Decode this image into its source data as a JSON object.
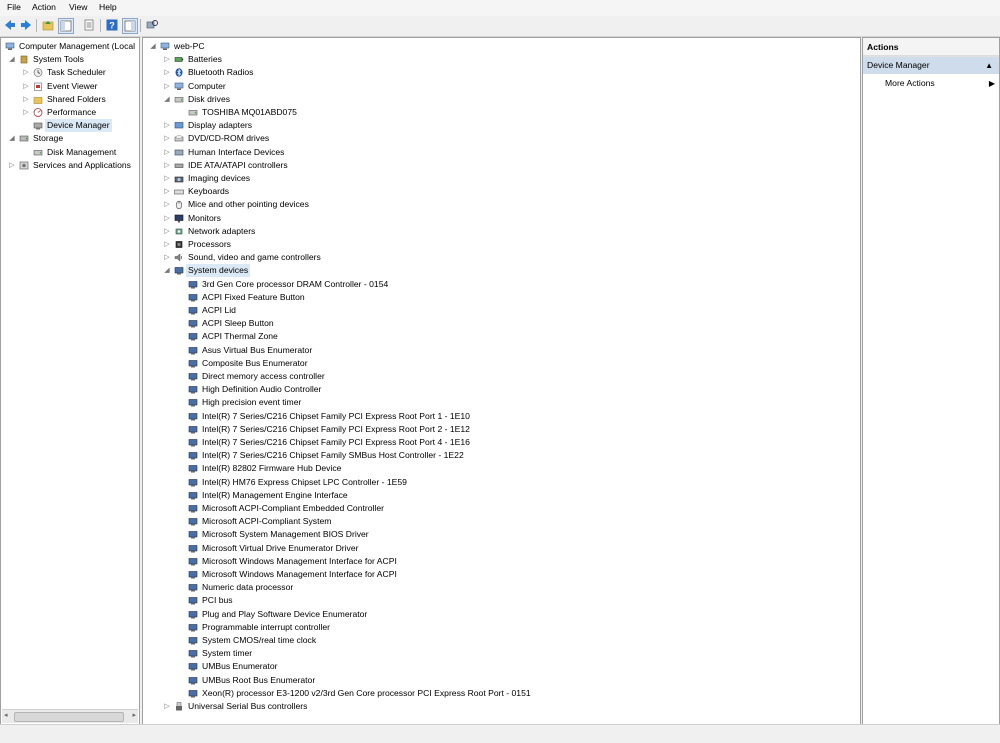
{
  "menu": {
    "file": "File",
    "action": "Action",
    "view": "View",
    "help": "Help"
  },
  "left_tree": [
    {
      "label": "Computer Management (Local",
      "level": 0,
      "exp": "",
      "icon": "computer-icon"
    },
    {
      "label": "System Tools",
      "level": 1,
      "exp": "◢",
      "icon": "tools-icon"
    },
    {
      "label": "Task Scheduler",
      "level": 2,
      "exp": "▷",
      "icon": "clock-icon"
    },
    {
      "label": "Event Viewer",
      "level": 2,
      "exp": "▷",
      "icon": "log-icon"
    },
    {
      "label": "Shared Folders",
      "level": 2,
      "exp": "▷",
      "icon": "folder-icon"
    },
    {
      "label": "Performance",
      "level": 2,
      "exp": "▷",
      "icon": "performance-icon"
    },
    {
      "label": "Device Manager",
      "level": 2,
      "exp": "",
      "icon": "device-manager-icon",
      "selected": true
    },
    {
      "label": "Storage",
      "level": 1,
      "exp": "◢",
      "icon": "storage-icon"
    },
    {
      "label": "Disk Management",
      "level": 2,
      "exp": "",
      "icon": "disk-icon"
    },
    {
      "label": "Services and Applications",
      "level": 1,
      "exp": "▷",
      "icon": "services-icon"
    }
  ],
  "device_tree": [
    {
      "label": "web-PC",
      "level": 0,
      "exp": "◢",
      "icon": "computer-icon"
    },
    {
      "label": "Batteries",
      "level": 1,
      "exp": "▷",
      "icon": "battery-icon"
    },
    {
      "label": "Bluetooth Radios",
      "level": 1,
      "exp": "▷",
      "icon": "bluetooth-icon"
    },
    {
      "label": "Computer",
      "level": 1,
      "exp": "▷",
      "icon": "computer-icon"
    },
    {
      "label": "Disk drives",
      "level": 1,
      "exp": "◢",
      "icon": "disk-icon"
    },
    {
      "label": "TOSHIBA MQ01ABD075",
      "level": 2,
      "exp": "",
      "icon": "disk-icon"
    },
    {
      "label": "Display adapters",
      "level": 1,
      "exp": "▷",
      "icon": "display-icon"
    },
    {
      "label": "DVD/CD-ROM drives",
      "level": 1,
      "exp": "▷",
      "icon": "dvd-icon"
    },
    {
      "label": "Human Interface Devices",
      "level": 1,
      "exp": "▷",
      "icon": "hid-icon"
    },
    {
      "label": "IDE ATA/ATAPI controllers",
      "level": 1,
      "exp": "▷",
      "icon": "ide-icon"
    },
    {
      "label": "Imaging devices",
      "level": 1,
      "exp": "▷",
      "icon": "camera-icon"
    },
    {
      "label": "Keyboards",
      "level": 1,
      "exp": "▷",
      "icon": "keyboard-icon"
    },
    {
      "label": "Mice and other pointing devices",
      "level": 1,
      "exp": "▷",
      "icon": "mouse-icon"
    },
    {
      "label": "Monitors",
      "level": 1,
      "exp": "▷",
      "icon": "monitor-icon"
    },
    {
      "label": "Network adapters",
      "level": 1,
      "exp": "▷",
      "icon": "network-icon"
    },
    {
      "label": "Processors",
      "level": 1,
      "exp": "▷",
      "icon": "processor-icon"
    },
    {
      "label": "Sound, video and game controllers",
      "level": 1,
      "exp": "▷",
      "icon": "sound-icon"
    },
    {
      "label": "System devices",
      "level": 1,
      "exp": "◢",
      "icon": "system-device-icon",
      "selected": true
    },
    {
      "label": "3rd Gen Core processor DRAM Controller - 0154",
      "level": 2,
      "exp": "",
      "icon": "system-device-icon"
    },
    {
      "label": "ACPI Fixed Feature Button",
      "level": 2,
      "exp": "",
      "icon": "system-device-icon"
    },
    {
      "label": "ACPI Lid",
      "level": 2,
      "exp": "",
      "icon": "system-device-icon"
    },
    {
      "label": "ACPI Sleep Button",
      "level": 2,
      "exp": "",
      "icon": "system-device-icon"
    },
    {
      "label": "ACPI Thermal Zone",
      "level": 2,
      "exp": "",
      "icon": "system-device-icon"
    },
    {
      "label": "Asus Virtual Bus Enumerator",
      "level": 2,
      "exp": "",
      "icon": "system-device-icon"
    },
    {
      "label": "Composite Bus Enumerator",
      "level": 2,
      "exp": "",
      "icon": "system-device-icon"
    },
    {
      "label": "Direct memory access controller",
      "level": 2,
      "exp": "",
      "icon": "system-device-icon"
    },
    {
      "label": "High Definition Audio Controller",
      "level": 2,
      "exp": "",
      "icon": "system-device-icon"
    },
    {
      "label": "High precision event timer",
      "level": 2,
      "exp": "",
      "icon": "system-device-icon"
    },
    {
      "label": "Intel(R) 7 Series/C216 Chipset Family PCI Express Root Port 1 - 1E10",
      "level": 2,
      "exp": "",
      "icon": "system-device-icon"
    },
    {
      "label": "Intel(R) 7 Series/C216 Chipset Family PCI Express Root Port 2 - 1E12",
      "level": 2,
      "exp": "",
      "icon": "system-device-icon"
    },
    {
      "label": "Intel(R) 7 Series/C216 Chipset Family PCI Express Root Port 4 - 1E16",
      "level": 2,
      "exp": "",
      "icon": "system-device-icon"
    },
    {
      "label": "Intel(R) 7 Series/C216 Chipset Family SMBus Host Controller - 1E22",
      "level": 2,
      "exp": "",
      "icon": "system-device-icon"
    },
    {
      "label": "Intel(R) 82802 Firmware Hub Device",
      "level": 2,
      "exp": "",
      "icon": "system-device-icon"
    },
    {
      "label": "Intel(R) HM76 Express Chipset LPC Controller - 1E59",
      "level": 2,
      "exp": "",
      "icon": "system-device-icon"
    },
    {
      "label": "Intel(R) Management Engine Interface",
      "level": 2,
      "exp": "",
      "icon": "system-device-icon"
    },
    {
      "label": "Microsoft ACPI-Compliant Embedded Controller",
      "level": 2,
      "exp": "",
      "icon": "system-device-icon"
    },
    {
      "label": "Microsoft ACPI-Compliant System",
      "level": 2,
      "exp": "",
      "icon": "system-device-icon"
    },
    {
      "label": "Microsoft System Management BIOS Driver",
      "level": 2,
      "exp": "",
      "icon": "system-device-icon"
    },
    {
      "label": "Microsoft Virtual Drive Enumerator Driver",
      "level": 2,
      "exp": "",
      "icon": "system-device-icon"
    },
    {
      "label": "Microsoft Windows Management Interface for ACPI",
      "level": 2,
      "exp": "",
      "icon": "system-device-icon"
    },
    {
      "label": "Microsoft Windows Management Interface for ACPI",
      "level": 2,
      "exp": "",
      "icon": "system-device-icon"
    },
    {
      "label": "Numeric data processor",
      "level": 2,
      "exp": "",
      "icon": "system-device-icon"
    },
    {
      "label": "PCI bus",
      "level": 2,
      "exp": "",
      "icon": "system-device-icon"
    },
    {
      "label": "Plug and Play Software Device Enumerator",
      "level": 2,
      "exp": "",
      "icon": "system-device-icon"
    },
    {
      "label": "Programmable interrupt controller",
      "level": 2,
      "exp": "",
      "icon": "system-device-icon"
    },
    {
      "label": "System CMOS/real time clock",
      "level": 2,
      "exp": "",
      "icon": "system-device-icon"
    },
    {
      "label": "System timer",
      "level": 2,
      "exp": "",
      "icon": "system-device-icon"
    },
    {
      "label": "UMBus Enumerator",
      "level": 2,
      "exp": "",
      "icon": "system-device-icon"
    },
    {
      "label": "UMBus Root Bus Enumerator",
      "level": 2,
      "exp": "",
      "icon": "system-device-icon"
    },
    {
      "label": "Xeon(R) processor E3-1200 v2/3rd Gen Core processor PCI Express Root Port - 0151",
      "level": 2,
      "exp": "",
      "icon": "system-device-icon"
    },
    {
      "label": "Universal Serial Bus controllers",
      "level": 1,
      "exp": "▷",
      "icon": "usb-icon"
    }
  ],
  "actions": {
    "title": "Actions",
    "section": "Device Manager",
    "more": "More Actions"
  },
  "colors": {
    "selection": "#dbe8f5",
    "section_bg": "#cfdceb",
    "border": "#a0a0a0"
  }
}
